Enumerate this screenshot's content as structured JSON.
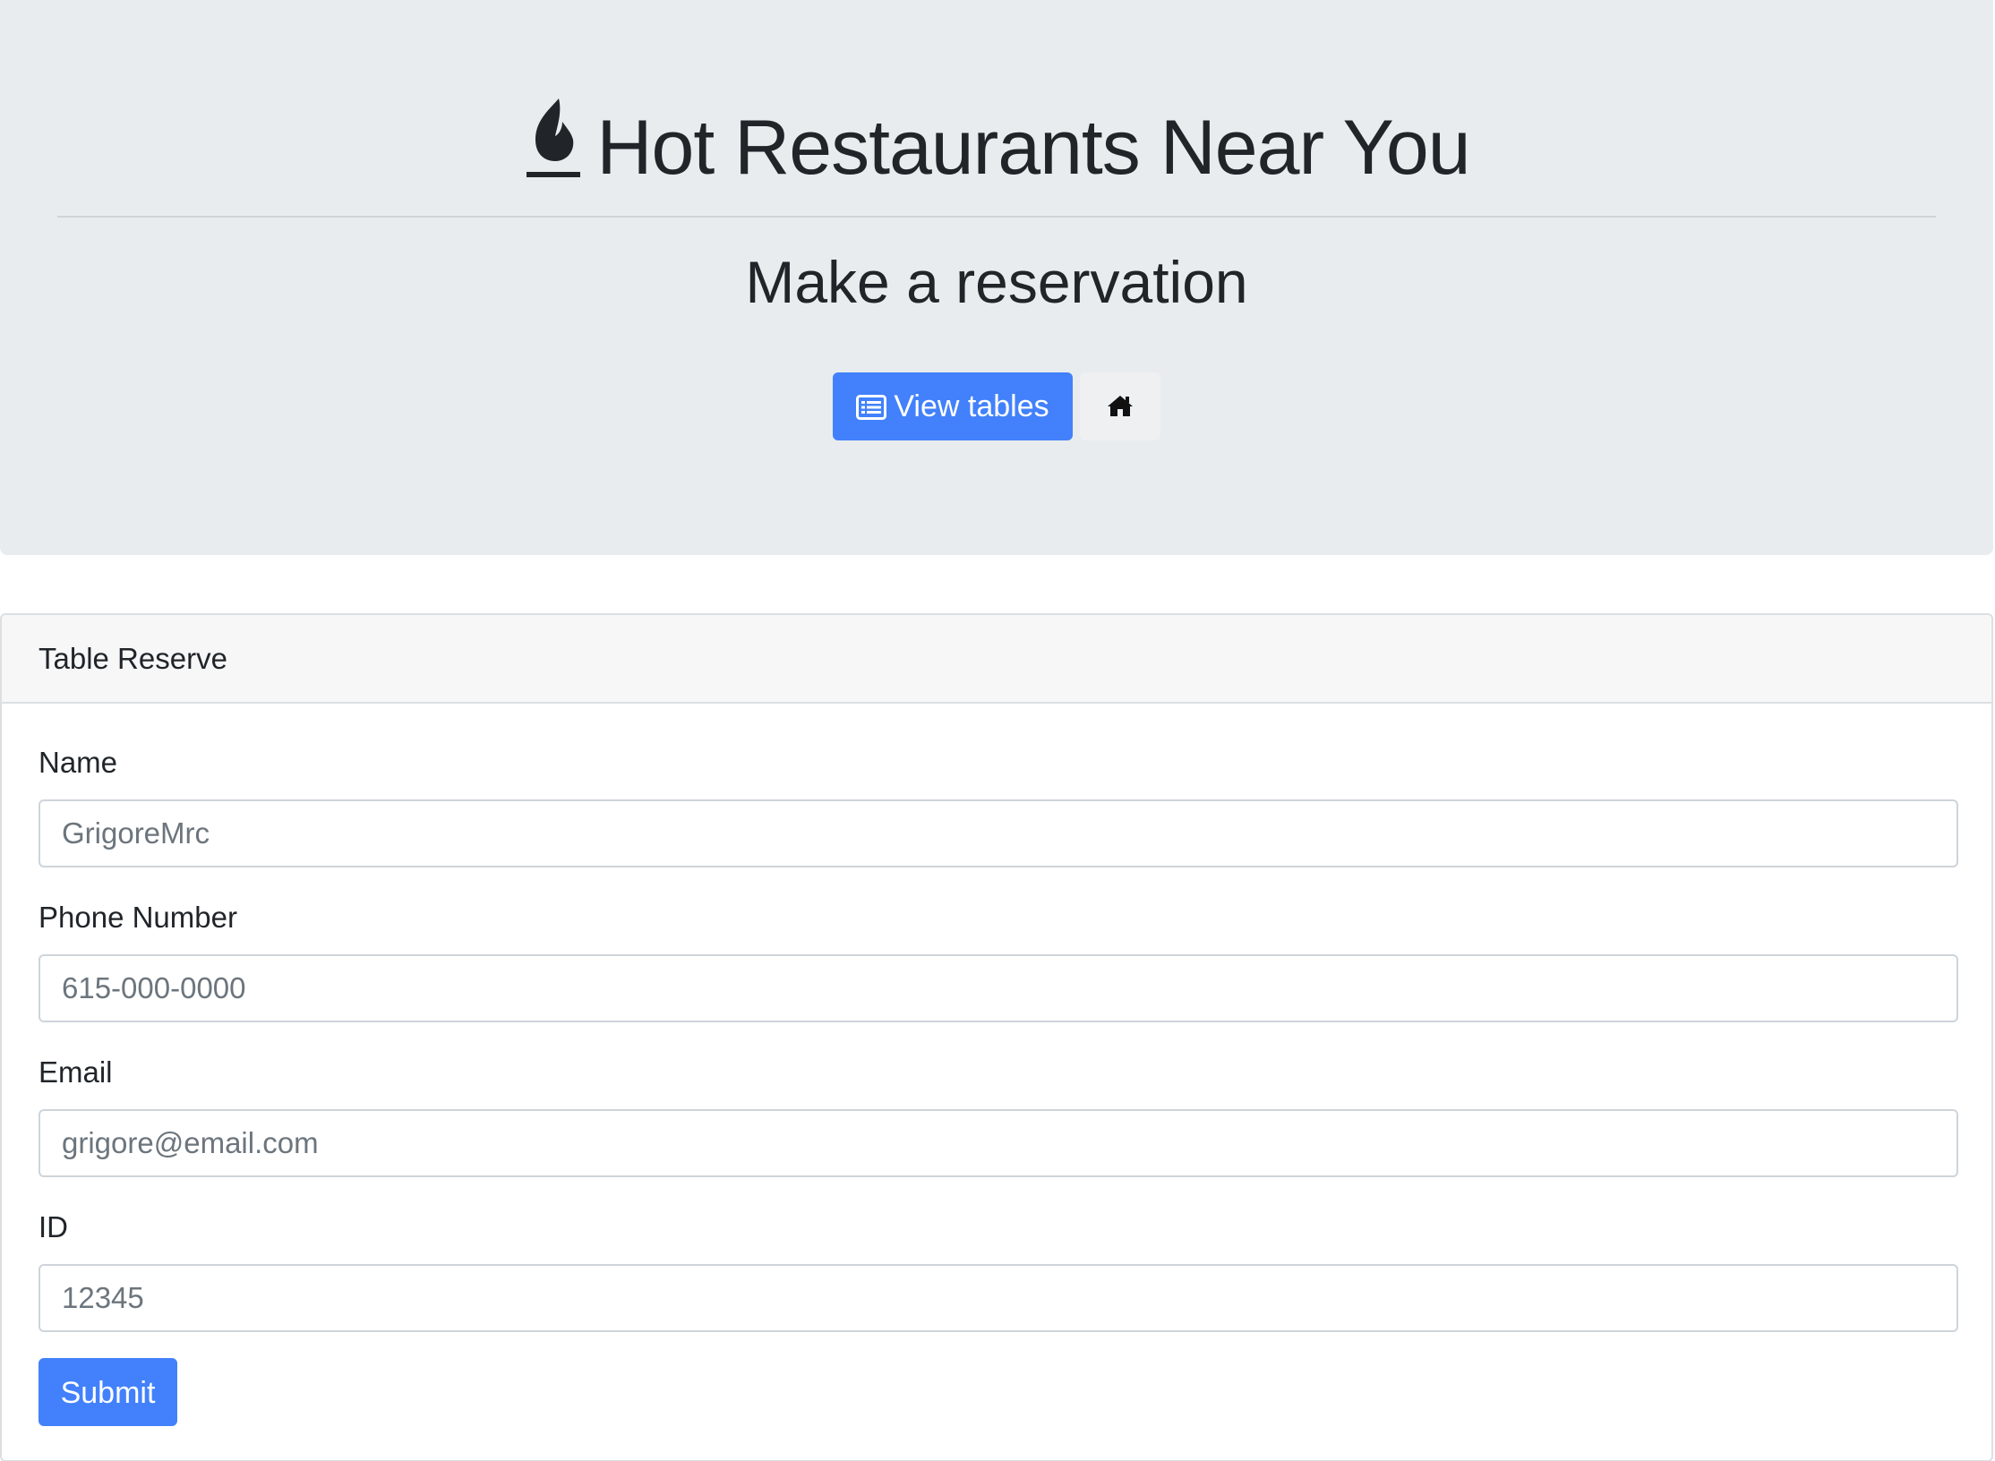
{
  "header": {
    "icon": "fire-icon",
    "title": "Hot Restaurants Near You",
    "subtitle": "Make a reservation",
    "view_tables_icon": "list-icon",
    "view_tables_label": "View tables",
    "home_icon": "home-icon"
  },
  "card": {
    "title": "Table Reserve",
    "fields": [
      {
        "label": "Name",
        "placeholder": "GrigoreMrc"
      },
      {
        "label": "Phone Number",
        "placeholder": "615-000-0000"
      },
      {
        "label": "Email",
        "placeholder": "grigore@email.com"
      },
      {
        "label": "ID",
        "placeholder": "12345"
      }
    ],
    "submit_label": "Submit"
  },
  "colors": {
    "primary": "#4281fb",
    "jumbotron_bg": "#e9ecef",
    "card_header_bg": "#f7f7f7",
    "text": "#212529"
  }
}
